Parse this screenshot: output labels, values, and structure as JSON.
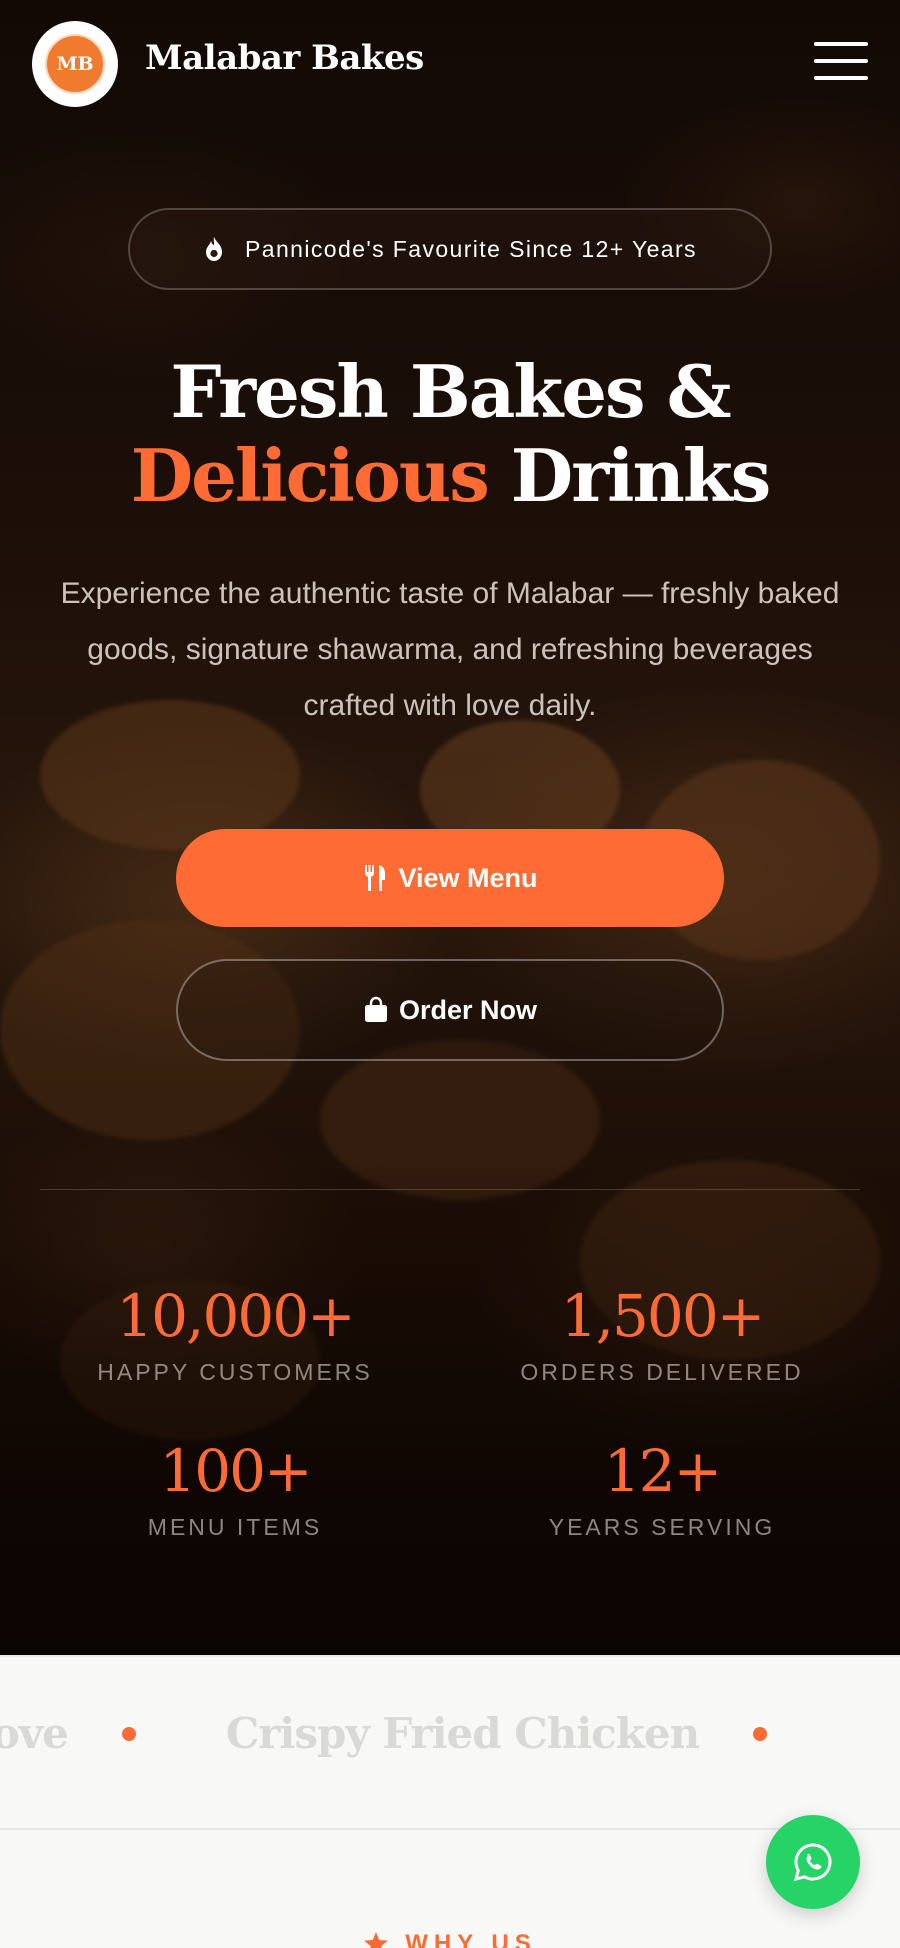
{
  "header": {
    "brand_name": "Malabar Bakes",
    "logo_text": "MB"
  },
  "hero": {
    "badge": "Pannicode's Favourite Since 12+ Years",
    "title_line1": "Fresh Bakes &",
    "title_accent": "Delicious",
    "title_rest": " Drinks",
    "subtitle": "Experience the authentic taste of Malabar — freshly baked goods, signature shawarma, and refreshing beverages crafted with love daily.",
    "primary_button": "View Menu",
    "secondary_button": "Order Now"
  },
  "stats": [
    {
      "value": "10,000+",
      "label": "HAPPY CUSTOMERS"
    },
    {
      "value": "1,500+",
      "label": "ORDERS DELIVERED"
    },
    {
      "value": "100+",
      "label": "MENU ITEMS"
    },
    {
      "value": "12+",
      "label": "YEARS SERVING"
    }
  ],
  "marquee": {
    "items": [
      "h Love",
      "Crispy Fried Chicken"
    ]
  },
  "next_section": {
    "tag": "WHY US"
  },
  "colors": {
    "accent": "#ff6b35",
    "whatsapp": "#25d366",
    "marquee_text": "#d9d9d6"
  },
  "icons": {
    "menu": "hamburger-icon",
    "badge": "fire-icon",
    "primary_button": "utensils-icon",
    "secondary_button": "shopping-bag-icon",
    "floating": "whatsapp-icon"
  }
}
